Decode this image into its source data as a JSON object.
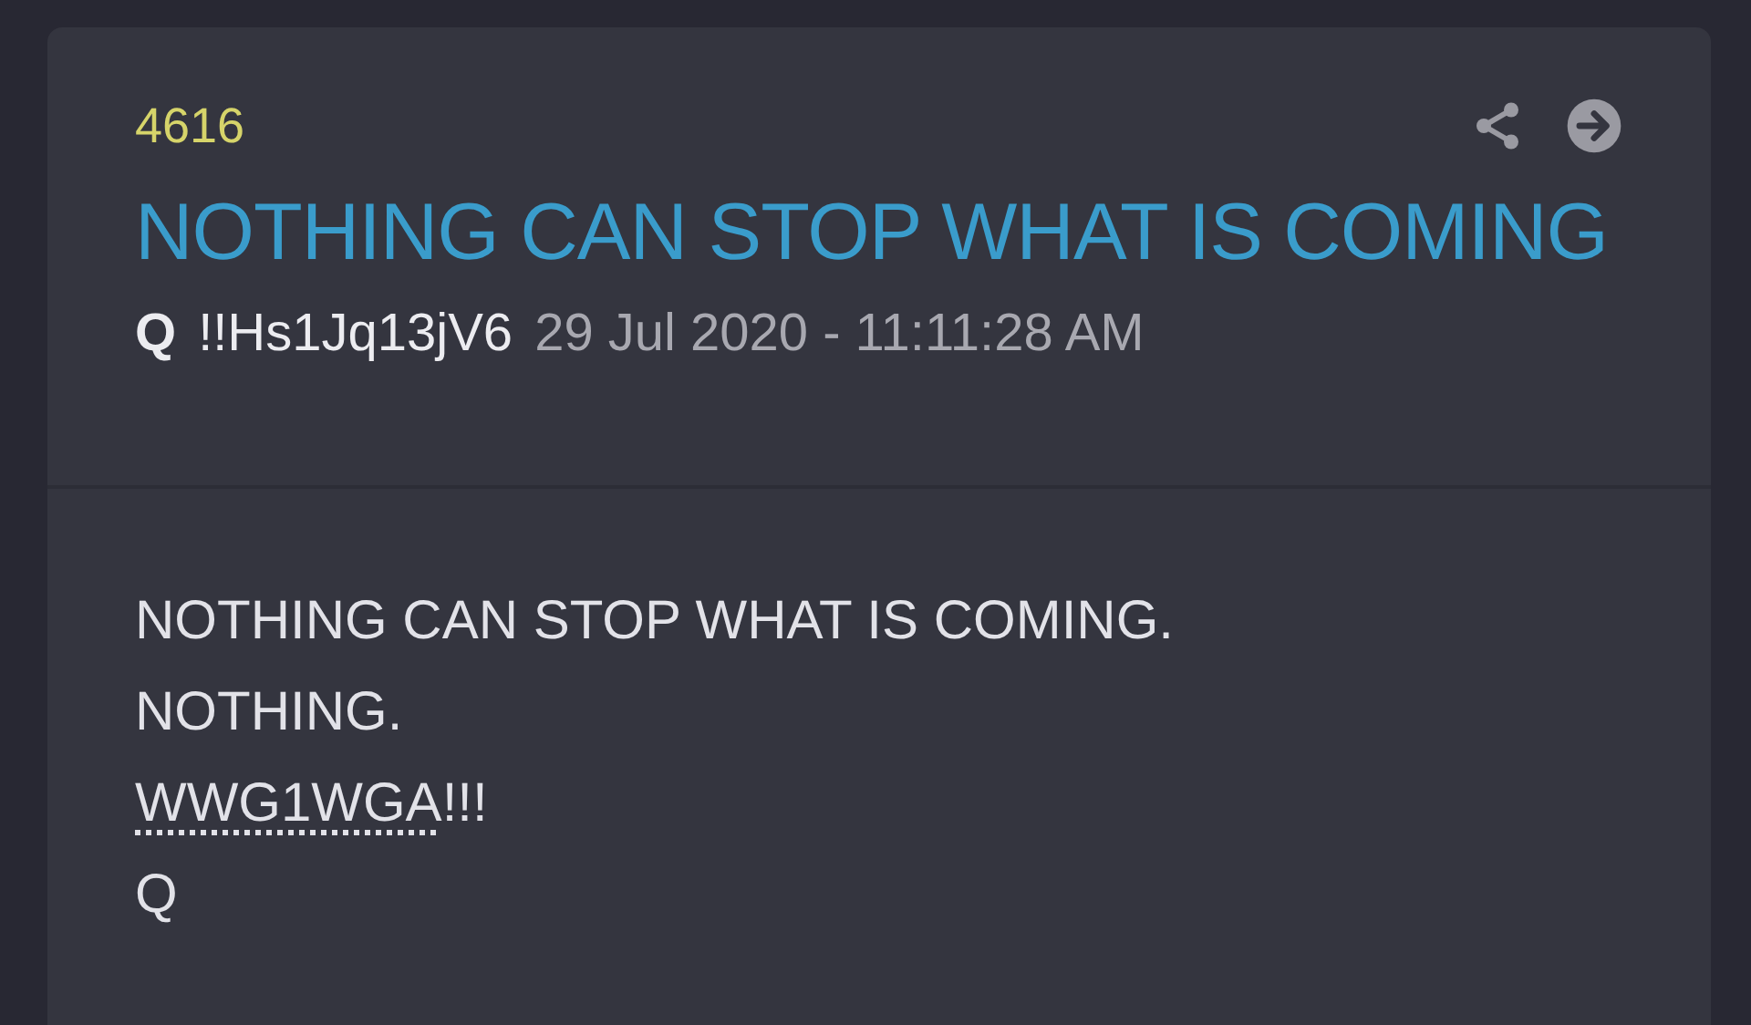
{
  "post": {
    "number": "4616",
    "title": "NOTHING CAN STOP WHAT IS COMING",
    "author": "Q",
    "tripcode": "!!Hs1Jq13jV6",
    "timestamp": "29 Jul 2020 - 11:11:28 AM",
    "body": [
      {
        "segments": [
          {
            "text": "NOTHING CAN STOP WHAT IS COMING.",
            "abbr": false
          }
        ]
      },
      {
        "segments": [
          {
            "text": "NOTHING.",
            "abbr": false
          }
        ]
      },
      {
        "segments": [
          {
            "text": "WWG1WGA",
            "abbr": true
          },
          {
            "text": "!!!",
            "abbr": false
          }
        ]
      },
      {
        "segments": [
          {
            "text": "Q",
            "abbr": false
          }
        ]
      }
    ]
  }
}
